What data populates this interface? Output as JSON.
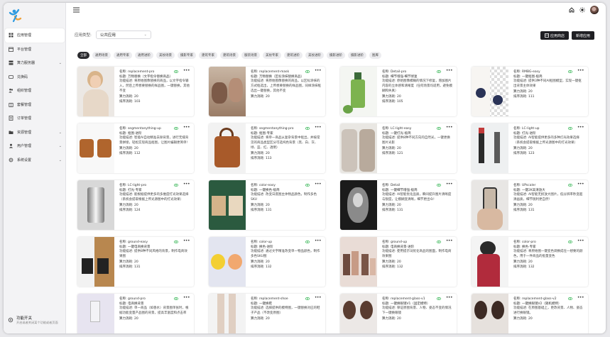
{
  "sidebar": {
    "items": [
      {
        "label": "应用管理",
        "icon": "grid-icon",
        "active": true,
        "chev": false
      },
      {
        "label": "平台管理",
        "icon": "calendar-icon",
        "active": false,
        "chev": false
      },
      {
        "label": "算力服务器",
        "icon": "server-icon",
        "active": false,
        "chev": true
      },
      {
        "label": "兑换码",
        "icon": "ticket-icon",
        "active": false,
        "chev": false
      },
      {
        "label": "组织管理",
        "icon": "users-icon",
        "active": false,
        "chev": false
      },
      {
        "label": "套餐管理",
        "icon": "package-icon",
        "active": false,
        "chev": false
      },
      {
        "label": "订单管理",
        "icon": "order-icon",
        "active": false,
        "chev": false
      },
      {
        "label": "资源管理",
        "icon": "folder-icon",
        "active": false,
        "chev": true
      },
      {
        "label": "用户管理",
        "icon": "user-icon",
        "active": false,
        "chev": true
      },
      {
        "label": "系统设置",
        "icon": "settings-icon",
        "active": false,
        "chev": true
      }
    ],
    "feature": {
      "title": "功能开关",
      "desc": "开启或者关闭某个功能或者页面"
    }
  },
  "filter": {
    "label": "应用类型:",
    "value": "公共应用"
  },
  "buttons": {
    "store": "应用商店",
    "new": "新增应用"
  },
  "tags": [
    "全部",
    "通用场景",
    "通用专家",
    "通用进阶",
    "美妆场景",
    "摄影专家",
    "建筑专家",
    "建筑场景",
    "服装场景",
    "美妆专家",
    "建筑进阶",
    "美妆进阶",
    "摄影进阶",
    "摄影进阶",
    "图库"
  ],
  "labels": {
    "name": "名称: ",
    "tag": "标题: ",
    "desc": "功能描述: ",
    "power": "算力消耗: ",
    "sort": "排序消耗: "
  },
  "cards": [
    {
      "name": "replacement-pro",
      "tag": "万物替换（文字指令替换商品）",
      "desc": "将原始图像替换的商品，以文字指令输入，然后上传想要替换的样品图，一键替换，其他不变",
      "power": "20",
      "sort": "103",
      "thumb": "woman"
    },
    {
      "name": "replacement-mask",
      "tag": "万物替换（区标涂抹替换商品）",
      "desc": "将原始图像替换的商品，以区标涂抹的方式框选出，上传想要替换的样品图，同样涂抹框选出一键替换，其他不变",
      "power": "20",
      "sort": "",
      "thumb": "rocks"
    },
    {
      "name": "Detail-pro",
      "tag": "细节增强-细节修复",
      "desc": "原始图像模糊的情况下修复，增加图片内容的立体感和清晰度（任何场景均适用，避免模糊和失真）",
      "power": "20",
      "sort": "105",
      "thumb": "bottle"
    },
    {
      "name": "RMBG-easy",
      "tag": "一键抠图-极简",
      "desc": "提供3种不同AI抠图模型，实现一键抠出背景主体效果",
      "power": "20",
      "sort": "111",
      "thumb": "fruit"
    },
    {
      "name": "segmentanything-up",
      "tag": "抠图-进阶",
      "desc": "智能AI自动精准去除背景，进行无缝背景拼接，轻松实现商品抠图，让图片编辑更简单!",
      "power": "20",
      "sort": "112",
      "thumb": "bags"
    },
    {
      "name": "segmentanything-pro",
      "tag": "抠图-专家",
      "desc": "将单一商品从复杂背景中抠出，并按常见的商品类型区分可选纯色背景（黑、白、灰、绿、蓝、红、透明）",
      "power": "20",
      "sort": "113",
      "thumb": "bag"
    },
    {
      "name": "LC-light-easy",
      "tag": "一键打光-极简",
      "desc": "提供8种不同方向的自然光，一键更换图片光影",
      "power": "20",
      "sort": "121",
      "thumb": "girls"
    },
    {
      "name": "LC-light-up",
      "tag": "打光-进阶",
      "desc": "AI智能提供更多的多种灯光效果选择（系统会提取根据上传光源图中的打光效果）",
      "power": "20",
      "sort": "123",
      "thumb": "lipstick"
    },
    {
      "name": "LC-light-pro",
      "tag": "打光-专家",
      "desc": "能根据提供更多的多维度打光效果选择（系统会提取根据上传光源图中的打光效果）",
      "power": "20",
      "sort": "124",
      "thumb": "glass"
    },
    {
      "name": "color-easy",
      "tag": "一键换色-极简",
      "desc": "改变日底图主体物品颜色，制作多色SKU",
      "power": "20",
      "sort": "131",
      "thumb": "totes"
    },
    {
      "name": "Detail",
      "tag": "一键细节增强-极简",
      "desc": "AI智能优化品质，瞬间提升图片清晰度与锐度，让模糊变清晰，细节更出众!",
      "power": "20",
      "sort": "131",
      "thumb": "portrait"
    },
    {
      "name": "UPscaler",
      "tag": "一键2K高清放大",
      "desc": "AI智能无损放大图片，低分辨率秒变超清画质，细节锐利更自然!",
      "power": "20",
      "sort": "131",
      "thumb": "phone"
    },
    {
      "name": "ground-easy",
      "tag": "一键电商换背景",
      "desc": "提供8种不同风格的背景，制作电商效果图",
      "power": "20",
      "sort": "131",
      "thumb": "chairs"
    },
    {
      "name": "color-up",
      "tag": "换色-进阶",
      "desc": "通过文字精准改变单一物品颜色，制作多色SKU图",
      "power": "20",
      "sort": "132",
      "thumb": "ducks"
    },
    {
      "name": "ground-up",
      "tag": "电商换背景-进阶",
      "desc": "使用提示词优化商品的图面，制作电商效果图",
      "power": "20",
      "sort": "132",
      "thumb": "jars"
    },
    {
      "name": "color-pro",
      "tag": "换色-专家",
      "desc": "将原始图一键变色调换成任一想要的颜色，用于一件商品的批量变色",
      "power": "20",
      "sort": "132",
      "thumb": "model"
    },
    {
      "name": "ground-pro",
      "tag": "电商换背景",
      "desc": "单一商品（如香水）背景图单张时，根据功能变量产品图的背景，提高丰富度和点击率",
      "power": "20",
      "sort": "",
      "thumb": "perfume"
    },
    {
      "name": "replacement-shoe",
      "tag": "一键换鞋",
      "desc": "选择提供的模特图，一键替换对应的鞋子产品（不改变原图）",
      "power": "20",
      "sort": "",
      "thumb": "legs"
    },
    {
      "name": "replacement-glass-v1",
      "tag": "一键换眼镜V1（固定模特）",
      "desc": "保证原图背景、人物、姿态不变的情况下一键换眼镜",
      "power": "20",
      "sort": "",
      "thumb": "faces"
    },
    {
      "name": "replacement-glass-v2",
      "tag": "一键换眼镜V2（随机模特）",
      "desc": "在原图基础上，更改背景、人物、姿态进行换眼镜。",
      "power": "20",
      "sort": "",
      "thumb": "faces2"
    }
  ]
}
